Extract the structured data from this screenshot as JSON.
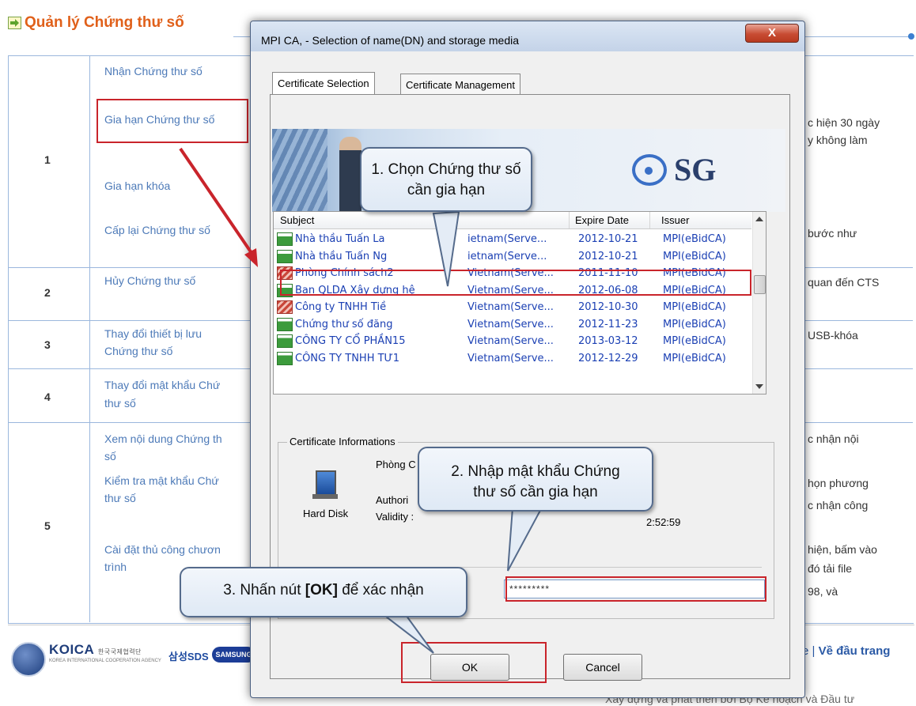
{
  "page": {
    "title": "Quản lý Chứng thư số",
    "rows": [
      {
        "num": "1",
        "items": [
          "Nhận Chứng thư số",
          "Gia hạn Chứng thư số",
          "Gia hạn khóa",
          "Cấp lại Chứng thư số"
        ]
      },
      {
        "num": "2",
        "items": [
          "Hủy Chứng thư số"
        ]
      },
      {
        "num": "3",
        "items": [
          "Thay đổi thiết bị lưu",
          "Chứng thư số"
        ]
      },
      {
        "num": "4",
        "items": [
          "Thay đổi mật khẩu Chứ",
          "thư số"
        ]
      },
      {
        "num": "5",
        "items": [
          "Xem nội dung Chứng th",
          "số",
          "Kiểm tra mật khẩu Chứ",
          "thư số",
          "Cài đặt thủ công chươn",
          "trình"
        ]
      }
    ],
    "right_text": [
      "c hiện 30 ngày",
      "y không làm",
      "bước như",
      "quan đến CTS",
      "USB-khóa",
      "c nhận nội",
      "họn phương",
      "c nhận công",
      "hiện, bấm vào",
      "đó tải file",
      "98, và"
    ],
    "footer": {
      "koica": "KOICA",
      "koica_korean": "한국국제협력단",
      "koica_sub": "KOREA INTERNATIONAL COOPERATION AGENCY",
      "samsung_sds": "삼성SDS",
      "samsung": "SAMSUNG",
      "separator": "e  |",
      "top_link": "Về đầu trang",
      "bottom_note": "Xây dựng và phát triển bởi Bộ Kế hoạch và Đầu tư"
    }
  },
  "dialog": {
    "title": "MPI CA, - Selection of name(DN) and storage media",
    "close_label": "X",
    "tabs": [
      {
        "label": "Certificate Selection",
        "active": true
      },
      {
        "label": "Certificate Management",
        "active": false
      }
    ],
    "banner_logo": "SG",
    "columns": [
      "Subject",
      "Expire Date",
      "Issuer"
    ],
    "certificates": [
      {
        "subject": "Nhà thầu Tuấn La",
        "org": "ietnam(Serve...",
        "expire": "2012-10-21",
        "issuer": "MPI(eBidCA)",
        "icon": "valid"
      },
      {
        "subject": "Nhà thầu Tuấn Ng",
        "org": "ietnam(Serve...",
        "expire": "2012-10-21",
        "issuer": "MPI(eBidCA)",
        "icon": "valid"
      },
      {
        "subject": "Phòng Chính sách2",
        "org": "Vietnam(Serve...",
        "expire": "2011-11-10",
        "issuer": "MPI(eBidCA)",
        "icon": "expired"
      },
      {
        "subject": "Ban QLDA Xây dựng hệ",
        "org": "Vietnam(Serve...",
        "expire": "2012-06-08",
        "issuer": "MPI(eBidCA)",
        "icon": "valid"
      },
      {
        "subject": "Công ty TNHH Tiề",
        "org": "Vietnam(Serve...",
        "expire": "2012-10-30",
        "issuer": "MPI(eBidCA)",
        "icon": "expired"
      },
      {
        "subject": "Chứng thư số đăng",
        "org": "Vietnam(Serve...",
        "expire": "2012-11-23",
        "issuer": "MPI(eBidCA)",
        "icon": "valid"
      },
      {
        "subject": "CÔNG TY CỔ PHẦN15",
        "org": "Vietnam(Serve...",
        "expire": "2013-03-12",
        "issuer": "MPI(eBidCA)",
        "icon": "valid"
      },
      {
        "subject": "CÔNG TY TNHH TƯ1",
        "org": "Vietnam(Serve...",
        "expire": "2012-12-29",
        "issuer": "MPI(eBidCA)",
        "icon": "valid"
      }
    ],
    "info": {
      "group_label": "Certificate Informations",
      "storage": "Hard Disk",
      "subject_partial": "Phòng C",
      "authority_label": "Authori",
      "validity_label": "Validity :",
      "validity_time": "2:52:59"
    },
    "password": "*********",
    "ok_label": "OK",
    "cancel_label": "Cancel"
  },
  "callouts": {
    "step1": "1. Chọn Chứng thư số cần gia hạn",
    "step2": "2. Nhập mật khẩu Chứng thư số cần gia hạn",
    "step3_prefix": "3. Nhấn nút ",
    "step3_bold": "[OK]",
    "step3_suffix": " để xác nhận"
  },
  "colors": {
    "title": "#e0601a",
    "link": "#4d7ab8",
    "highlight": "#c9242b",
    "list_text": "#1a3fb3"
  }
}
